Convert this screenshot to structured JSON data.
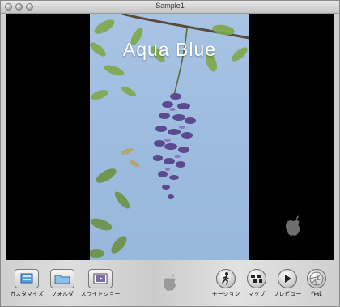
{
  "window": {
    "title": "Sample1"
  },
  "slide": {
    "title": "Aqua Blue"
  },
  "toolbar": {
    "left": [
      {
        "id": "customize",
        "label": "カスタマイズ",
        "icon": "customize-icon"
      },
      {
        "id": "folder",
        "label": "フォルダ",
        "icon": "folder-icon"
      },
      {
        "id": "slideshow",
        "label": "スライドショー",
        "icon": "slideshow-icon"
      }
    ],
    "center_icon": "apple-logo-icon",
    "right": [
      {
        "id": "motion",
        "label": "モーション",
        "icon": "walking-person-icon"
      },
      {
        "id": "map",
        "label": "マップ",
        "icon": "map-icon"
      },
      {
        "id": "preview",
        "label": "プレビュー",
        "icon": "play-icon"
      },
      {
        "id": "create",
        "label": "作成",
        "icon": "aperture-icon"
      }
    ]
  },
  "colors": {
    "sky": "#9cbbdf",
    "stage": "#000000",
    "title_text": "#ffffff"
  }
}
